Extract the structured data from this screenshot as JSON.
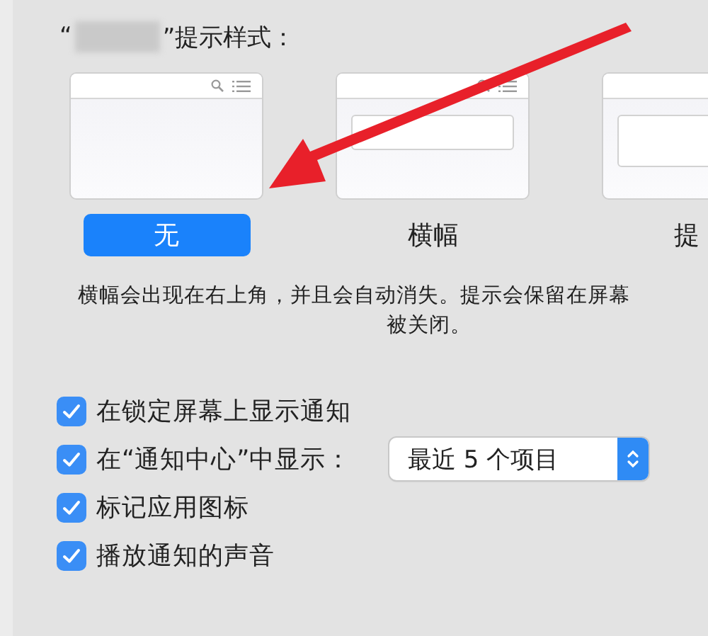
{
  "alert_style": {
    "title_open": "“",
    "title_close": "”提示样式：",
    "styles": [
      {
        "kind": "none",
        "label": "无",
        "selected": true
      },
      {
        "kind": "banner",
        "label": "横幅",
        "selected": false
      },
      {
        "kind": "alert",
        "label": "提",
        "selected": false
      }
    ],
    "description_lines": [
      "横幅会出现在右上角，并且会自动消失。提示会保留在屏幕",
      "被关闭。"
    ]
  },
  "options": [
    {
      "kind": "check",
      "label": "在锁定屏幕上显示通知",
      "checked": true
    },
    {
      "kind": "popup",
      "label": "在“通知中心”中显示：",
      "checked": true,
      "value": "最近 5 个项目"
    },
    {
      "kind": "check",
      "label": "标记应用图标",
      "checked": true
    },
    {
      "kind": "check",
      "label": "播放通知的声音",
      "checked": true
    }
  ]
}
